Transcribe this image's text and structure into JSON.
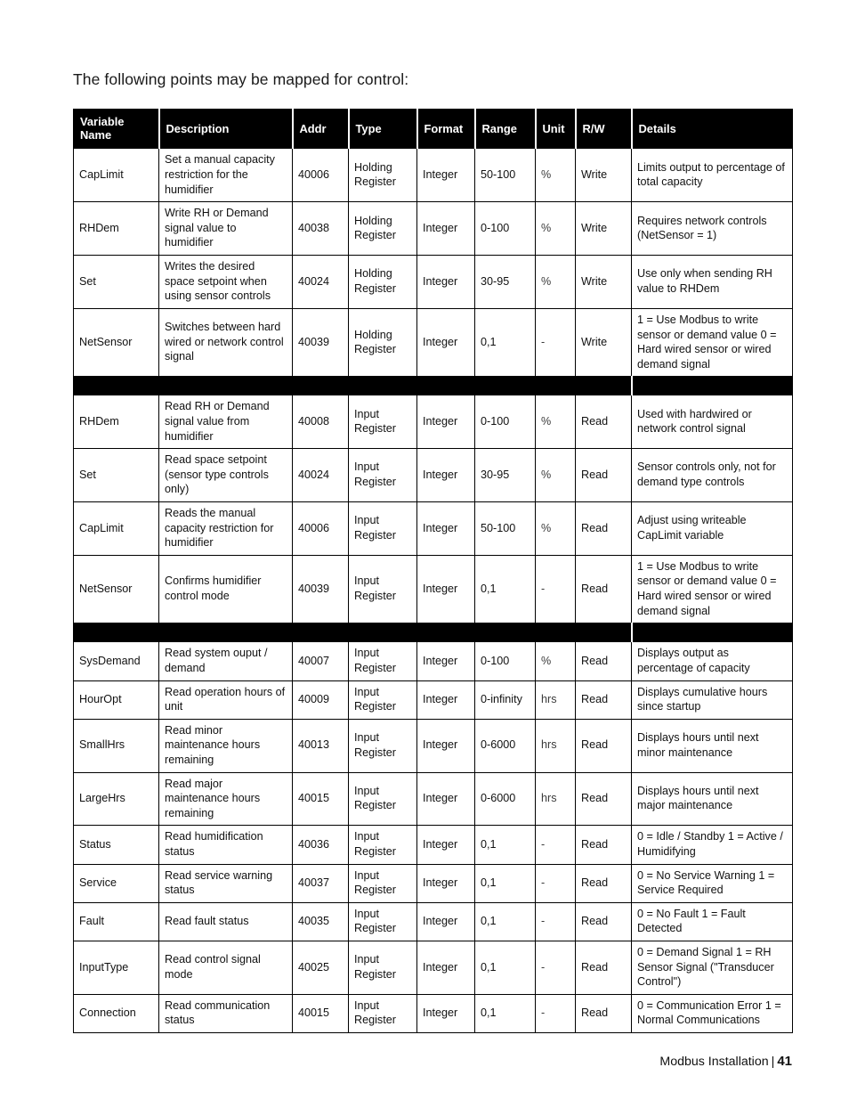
{
  "intro": "The following points may be mapped for control:",
  "table": {
    "columns": [
      "Variable Name",
      "Description",
      "Addr",
      "Type",
      "Format",
      "Range",
      "Unit",
      "R/W",
      "Details"
    ],
    "sections": [
      {
        "separator_before": false,
        "rows": [
          {
            "variable": "CapLimit",
            "description": "Set a manual capacity restriction for the humidifier",
            "addr": "40006",
            "type": "Holding Register",
            "format": "Integer",
            "range": "50-100",
            "unit": "%",
            "rw": "Write",
            "details": "Limits output to percentage of total capacity"
          },
          {
            "variable": "RHDem",
            "description": "Write RH or Demand signal value to humidifier",
            "addr": "40038",
            "type": "Holding Register",
            "format": "Integer",
            "range": "0-100",
            "unit": "%",
            "rw": "Write",
            "details": "Requires network controls (NetSensor = 1)"
          },
          {
            "variable": "Set",
            "description": "Writes the desired space setpoint when using sensor controls",
            "addr": "40024",
            "type": "Holding Register",
            "format": "Integer",
            "range": "30-95",
            "unit": "%",
            "rw": "Write",
            "details": "Use only when sending RH value to RHDem"
          },
          {
            "variable": "NetSensor",
            "description": "Switches between hard wired or network control signal",
            "addr": "40039",
            "type": "Holding Register",
            "format": "Integer",
            "range": "0,1",
            "unit": "-",
            "rw": "Write",
            "details": "1 = Use Modbus to write sensor or demand value 0 = Hard wired sensor or wired demand signal"
          }
        ]
      },
      {
        "separator_before": true,
        "rows": [
          {
            "variable": "RHDem",
            "description": "Read RH or Demand signal value from humidifier",
            "addr": "40008",
            "type": "Input Register",
            "format": "Integer",
            "range": "0-100",
            "unit": "%",
            "rw": "Read",
            "details": "Used with hardwired or network control signal"
          },
          {
            "variable": "Set",
            "description": "Read space setpoint (sensor type controls only)",
            "addr": "40024",
            "type": "Input Register",
            "format": "Integer",
            "range": "30-95",
            "unit": "%",
            "rw": "Read",
            "details": "Sensor controls only, not for demand type controls"
          },
          {
            "variable": "CapLimit",
            "description": "Reads the manual capacity restriction for humidifier",
            "addr": "40006",
            "type": "Input Register",
            "format": "Integer",
            "range": "50-100",
            "unit": "%",
            "rw": "Read",
            "details": "Adjust using writeable CapLimit variable"
          },
          {
            "variable": "NetSensor",
            "description": "Confirms humidifier control mode",
            "addr": "40039",
            "type": "Input Register",
            "format": "Integer",
            "range": "0,1",
            "unit": "-",
            "rw": "Read",
            "details": "1 = Use Modbus to write sensor or demand value 0 = Hard wired sensor or wired demand signal"
          }
        ]
      },
      {
        "separator_before": true,
        "rows": [
          {
            "variable": "SysDemand",
            "description": "Read system ouput / demand",
            "addr": "40007",
            "type": "Input Register",
            "format": "Integer",
            "range": "0-100",
            "unit": "%",
            "rw": "Read",
            "details": "Displays output as percentage of capacity"
          },
          {
            "variable": "HourOpt",
            "description": "Read operation hours of unit",
            "addr": "40009",
            "type": "Input Register",
            "format": "Integer",
            "range": "0-infinity",
            "unit": "hrs",
            "rw": "Read",
            "details": "Displays cumulative hours since startup"
          },
          {
            "variable": "SmallHrs",
            "description": "Read minor maintenance hours remaining",
            "addr": "40013",
            "type": "Input Register",
            "format": "Integer",
            "range": "0-6000",
            "unit": "hrs",
            "rw": "Read",
            "details": "Displays hours until next minor maintenance"
          },
          {
            "variable": "LargeHrs",
            "description": "Read major maintenance hours remaining",
            "addr": "40015",
            "type": "Input Register",
            "format": "Integer",
            "range": "0-6000",
            "unit": "hrs",
            "rw": "Read",
            "details": "Displays hours until next major maintenance"
          },
          {
            "variable": "Status",
            "description": "Read humidification status",
            "addr": "40036",
            "type": "Input Register",
            "format": "Integer",
            "range": "0,1",
            "unit": "-",
            "rw": "Read",
            "details": "0 = Idle / Standby 1 = Active / Humidifying"
          },
          {
            "variable": "Service",
            "description": "Read service warning status",
            "addr": "40037",
            "type": "Input Register",
            "format": "Integer",
            "range": "0,1",
            "unit": "-",
            "rw": "Read",
            "details": "0 = No Service Warning 1 = Service Required"
          },
          {
            "variable": "Fault",
            "description": "Read fault status",
            "addr": "40035",
            "type": "Input Register",
            "format": "Integer",
            "range": "0,1",
            "unit": "-",
            "rw": "Read",
            "details": "0 = No Fault 1 = Fault Detected"
          },
          {
            "variable": "InputType",
            "description": "Read control signal mode",
            "addr": "40025",
            "type": "Input Register",
            "format": "Integer",
            "range": "0,1",
            "unit": "-",
            "rw": "Read",
            "details": "0 = Demand Signal 1 = RH Sensor Signal (\"Transducer Control\")"
          },
          {
            "variable": "Connection",
            "description": "Read communication status",
            "addr": "40015",
            "type": "Input Register",
            "format": "Integer",
            "range": "0,1",
            "unit": "-",
            "rw": "Read",
            "details": "0 = Communication Error 1 = Normal Communications"
          }
        ]
      }
    ]
  },
  "footer": {
    "section": "Modbus Installation",
    "divider": "|",
    "page_number": "41"
  }
}
